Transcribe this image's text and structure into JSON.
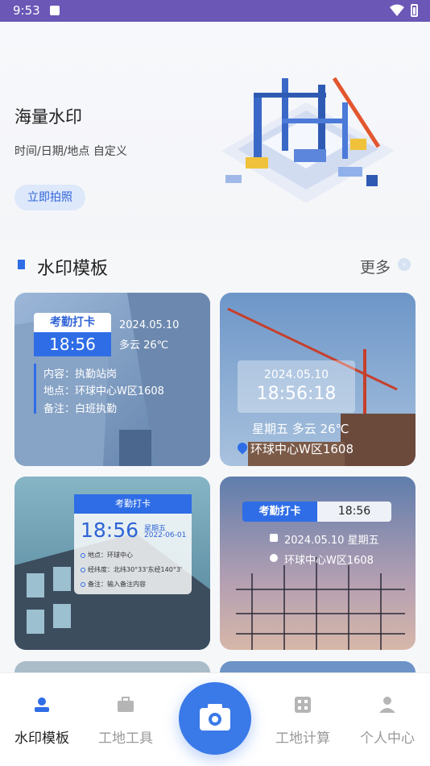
{
  "status_bar": {
    "time": "9:53"
  },
  "hero": {
    "title": "海量水印",
    "subtitle": "时间/日期/地点 自定义",
    "button_label": "立即拍照"
  },
  "section": {
    "title": "水印模板",
    "more_label": "更多"
  },
  "cards": [
    {
      "tag": "考勤打卡",
      "time": "18:56",
      "date": "2024.05.10",
      "weather": "多云 26℃",
      "rows": [
        "内容：执勤站岗",
        "地点：环球中心W区1608",
        "备注：白班执勤"
      ]
    },
    {
      "date": "2024.05.10",
      "time": "18:56:18",
      "week_weather": "星期五  多云 26℃",
      "location": "环球中心W区1608"
    },
    {
      "header": "考勤打卡",
      "time": "18:56",
      "week": "星期五",
      "date": "2022-06-01",
      "rows": [
        "地点：环球中心",
        "经纬度：北纬30°33'东经140°3'",
        "备注：输入备注内容"
      ]
    },
    {
      "tag": "考勤打卡",
      "time": "18:56",
      "date_week": "2024.05.10  星期五",
      "location": "环球中心W区1608"
    }
  ],
  "tabbar": {
    "items": [
      {
        "label": "水印模板",
        "icon": "user-badge-icon"
      },
      {
        "label": "工地工具",
        "icon": "toolbox-icon"
      },
      {
        "label": "工地计算",
        "icon": "calculator-icon"
      },
      {
        "label": "个人中心",
        "icon": "person-icon"
      }
    ],
    "camera_icon": "camera-icon"
  },
  "colors": {
    "accent": "#2f6de6",
    "status_bar": "#6a57b6"
  }
}
